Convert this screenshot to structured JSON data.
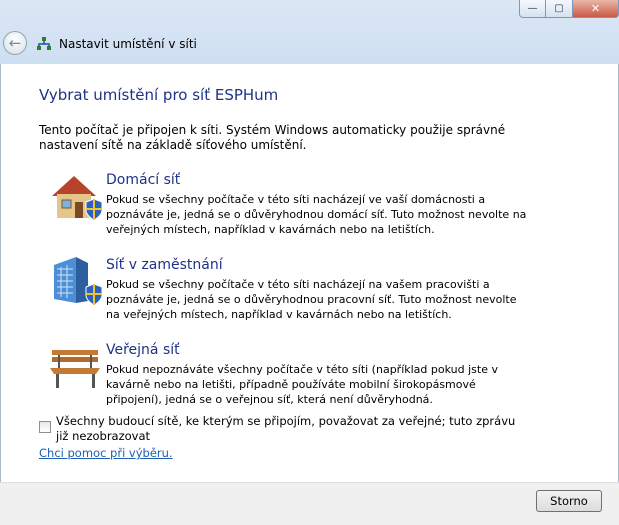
{
  "window": {
    "title": "Nastavit umístění v síti",
    "minimize_glyph": "—",
    "maximize_glyph": "▢",
    "close_glyph": "✕"
  },
  "heading": "Vybrat umístění pro síť ESPHum",
  "intro": "Tento počítač je připojen k síti. Systém Windows automaticky použije správné nastavení sítě na základě síťového umístění.",
  "options": [
    {
      "title": "Domácí síť",
      "description": "Pokud se všechny počítače v této síti nacházejí ve vaší domácnosti a poznáváte je, jedná se o důvěryhodnou domácí síť. Tuto možnost nevolte na veřejných místech, například v kavárnách nebo na letištích.",
      "icon": "home-network-icon"
    },
    {
      "title": "Síť v zaměstnání",
      "description": "Pokud se všechny počítače v této síti nacházejí na vašem pracovišti a poznáváte je, jedná se o důvěryhodnou pracovní síť. Tuto možnost nevolte na veřejných místech, například v kavárnách nebo na letištích.",
      "icon": "work-network-icon"
    },
    {
      "title": "Veřejná síť",
      "description": "Pokud nepoznáváte všechny počítače v této síti (například pokud jste v kavárně nebo na letišti, případně používáte mobilní širokopásmové připojení), jedná se o veřejnou síť, která není důvěryhodná.",
      "icon": "public-network-icon"
    }
  ],
  "checkbox": {
    "label": "Všechny budoucí sítě, ke kterým se připojím, považovat za veřejné; tuto zprávu již nezobrazovat",
    "checked": false
  },
  "help_link": "Chci pomoc při výběru.",
  "buttons": {
    "cancel": "Storno"
  },
  "colors": {
    "heading": "#1e3287",
    "link": "#1f5fb3",
    "footer": "#f0f0f0"
  }
}
